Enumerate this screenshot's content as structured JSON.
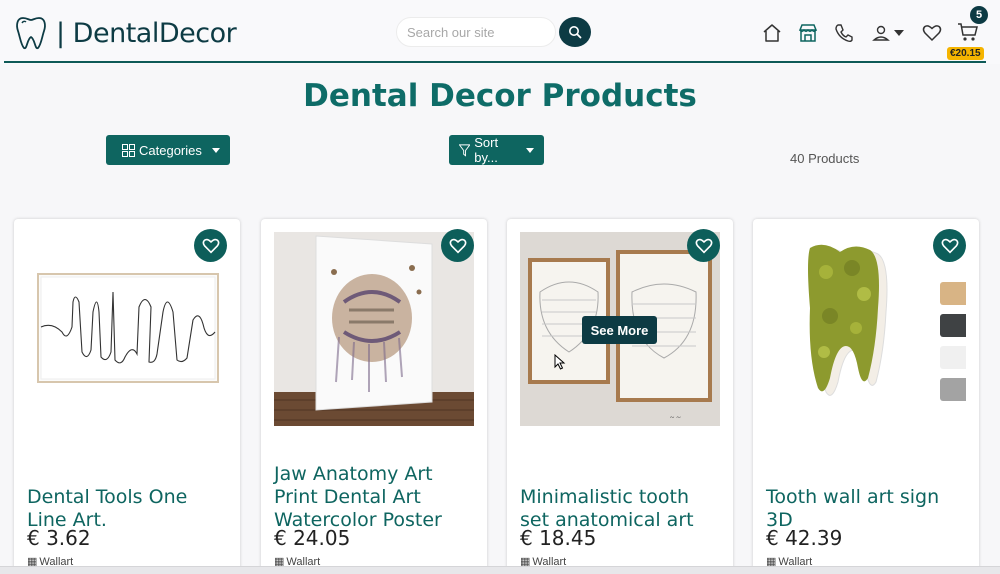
{
  "header": {
    "brand": "| DentalDecor",
    "search_placeholder": "Search our site",
    "icons": [
      "home-icon",
      "store-icon",
      "phone-icon",
      "user-icon",
      "heart-icon",
      "cart-icon"
    ],
    "cart_count": "5",
    "cart_total": "€20.15"
  },
  "main": {
    "title": "Dental Decor Products",
    "categories_label": "Categories",
    "sort_label": "Sort by...",
    "product_count": "40 Products"
  },
  "products": [
    {
      "title": "Dental Tools One Line Art.",
      "price": "€ 3.62",
      "category": "Wallart"
    },
    {
      "title": "Jaw Anatomy Art Print Dental Art Watercolor Poster",
      "price": "€ 24.05",
      "category": "Wallart"
    },
    {
      "title": "Minimalistic tooth set anatomical art",
      "price": "€ 18.45",
      "category": "Wallart",
      "overlay": "See More"
    },
    {
      "title": "Tooth wall art sign 3D",
      "price": "€ 42.39",
      "category": "Wallart"
    }
  ],
  "colors": {
    "brand_dark": "#0d3b44",
    "brand_teal": "#0e6560",
    "badge_yellow": "#f5b400",
    "swatches": [
      "#d8b485",
      "#3f4244",
      "#f0f0f0",
      "#a3a3a3"
    ]
  }
}
